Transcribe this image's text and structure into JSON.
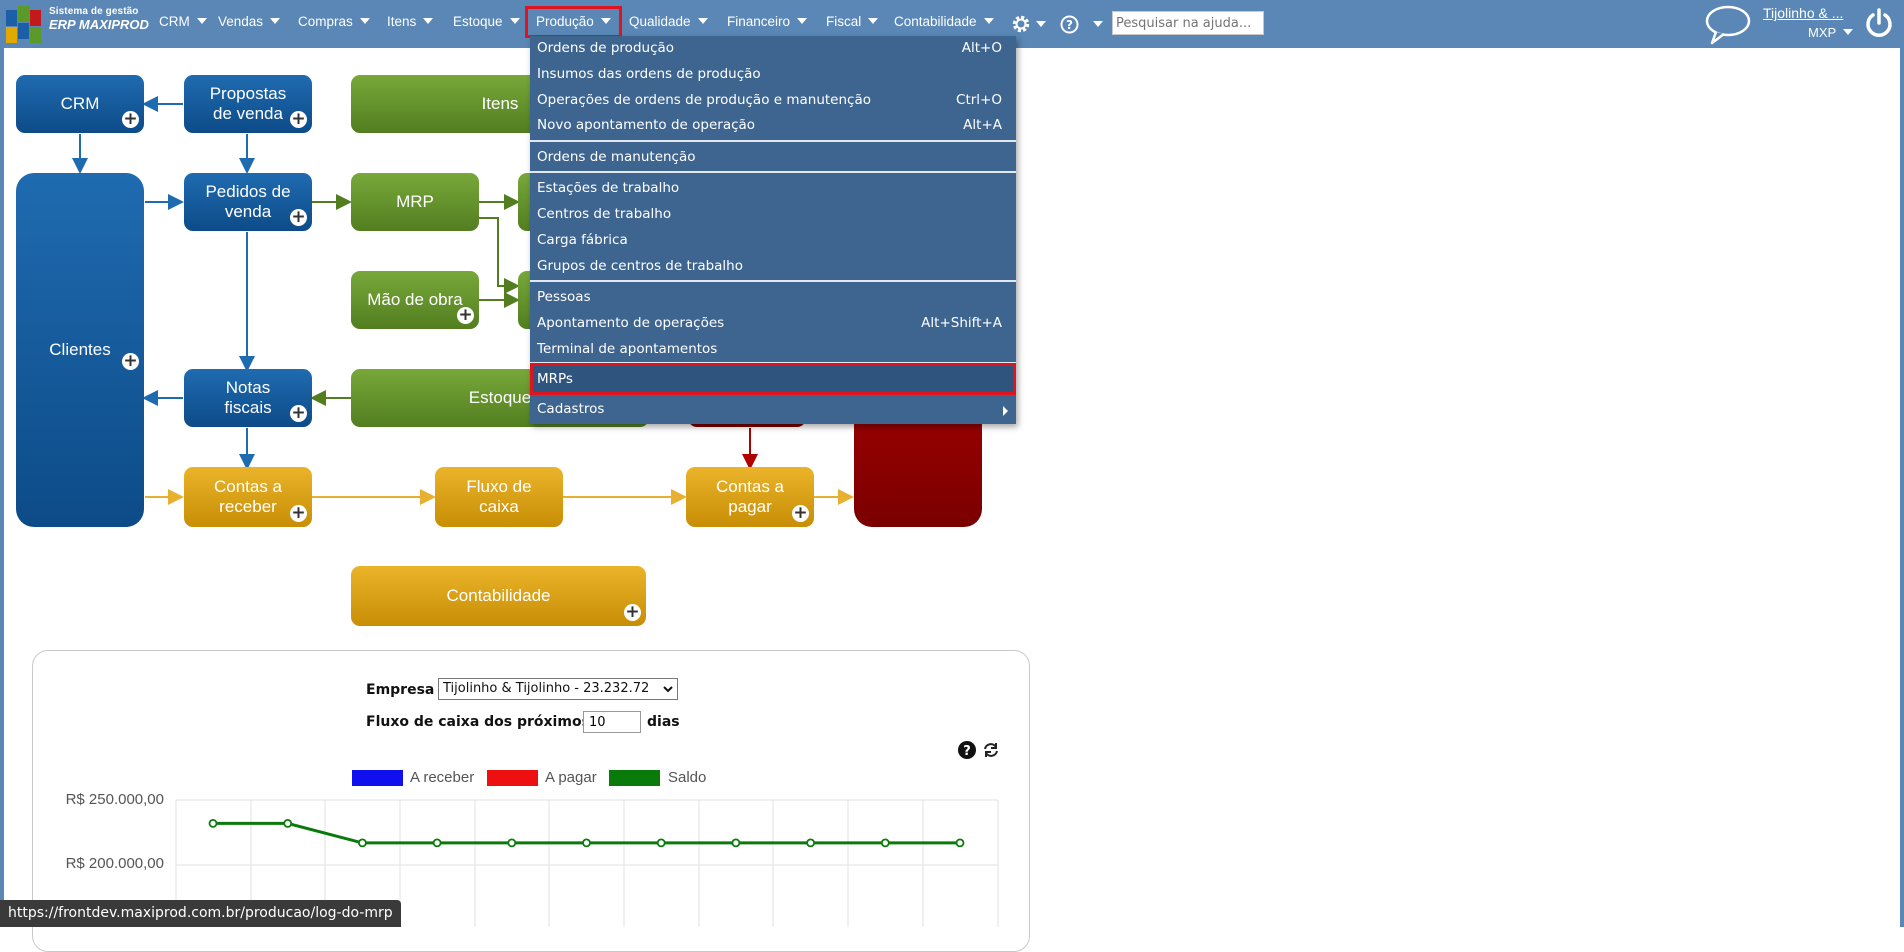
{
  "header": {
    "brand_line1": "Sistema de gestão",
    "brand_line2": "ERP MAXIPROD",
    "nav": [
      "CRM",
      "Vendas",
      "Compras",
      "Itens",
      "Estoque",
      "Produção",
      "Qualidade",
      "Financeiro",
      "Fiscal",
      "Contabilidade"
    ],
    "active_nav": "Produção",
    "search_placeholder": "Pesquisar na ajuda...",
    "user_name": "Tijolinho & ...",
    "user_company": "MXP"
  },
  "flow": {
    "crm": "CRM",
    "propostas": "Propostas de venda",
    "itens": "Itens",
    "clientes": "Clientes",
    "pedidos": "Pedidos de venda",
    "mrp": "MRP",
    "mao_de_obra": "Mão de obra",
    "notas": "Notas fiscais",
    "estoque": "Estoque",
    "contas_receber": "Contas a receber",
    "fluxo_caixa": "Fluxo de caixa",
    "contas_pagar": "Contas a pagar",
    "contabilidade": "Contabilidade"
  },
  "menu": {
    "items": [
      {
        "label": "Ordens de produção",
        "shortcut": "Alt+O"
      },
      {
        "label": "Insumos das ordens de produção",
        "shortcut": ""
      },
      {
        "label": "Operações de ordens de produção e manutenção",
        "shortcut": "Ctrl+O"
      },
      {
        "label": "Novo apontamento de operação",
        "shortcut": "Alt+A"
      },
      {
        "label": "Ordens de manutenção",
        "shortcut": ""
      },
      {
        "label": "Estações de trabalho",
        "shortcut": ""
      },
      {
        "label": "Centros de trabalho",
        "shortcut": ""
      },
      {
        "label": "Carga fábrica",
        "shortcut": ""
      },
      {
        "label": "Grupos de centros de trabalho",
        "shortcut": ""
      },
      {
        "label": "Pessoas",
        "shortcut": ""
      },
      {
        "label": "Apontamento de operações",
        "shortcut": "Alt+Shift+A"
      },
      {
        "label": "Terminal de apontamentos",
        "shortcut": ""
      },
      {
        "label": "MRPs",
        "shortcut": ""
      },
      {
        "label": "Cadastros",
        "shortcut": ""
      }
    ],
    "highlighted": "MRPs"
  },
  "cashflow": {
    "empresa_label": "Empresa",
    "empresa_value": "Tijolinho & Tijolinho - 23.232.72",
    "fluxo_label": "Fluxo de caixa dos próximos",
    "dias_value": "10",
    "dias_label": "dias"
  },
  "chart_data": {
    "type": "line",
    "legend": [
      "A receber",
      "A pagar",
      "Saldo"
    ],
    "colors": {
      "A receber": "#1010ee",
      "A pagar": "#ee1010",
      "Saldo": "#0a7a0a"
    },
    "yticks": [
      "R$ 250.000,00",
      "R$ 200.000,00"
    ],
    "ylim": [
      180000,
      260000
    ],
    "x": [
      1,
      2,
      3,
      4,
      5,
      6,
      7,
      8,
      9,
      10,
      11
    ],
    "series": [
      {
        "name": "Saldo",
        "values": [
          232000,
          232000,
          217000,
          217000,
          217000,
          217000,
          217000,
          217000,
          217000,
          217000,
          217000
        ]
      }
    ]
  },
  "status_bar": "https://frontdev.maxiprod.com.br/producao/log-do-mrp"
}
